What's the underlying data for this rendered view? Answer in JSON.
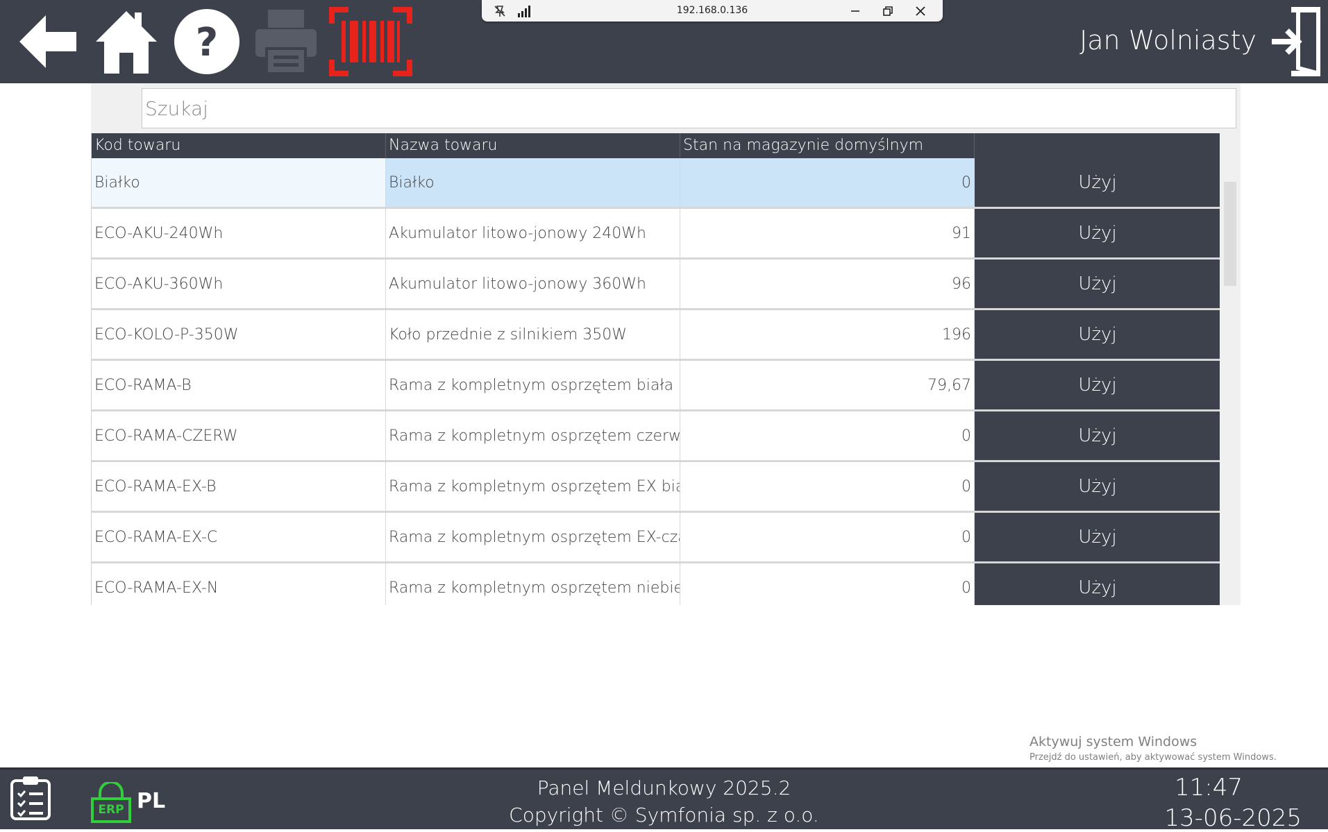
{
  "header": {
    "user_name": "Jan Wolniasty",
    "icons": [
      "back-arrow-icon",
      "home-icon",
      "help-icon",
      "printer-icon",
      "barcode-scanner-icon",
      "logout-icon"
    ]
  },
  "remote_session": {
    "address": "192.168.0.136"
  },
  "search": {
    "placeholder": "Szukaj",
    "value": ""
  },
  "table": {
    "columns": [
      "Kod towaru",
      "Nazwa towaru",
      "Stan na magazynie domyślnym",
      ""
    ],
    "rows": [
      {
        "code": "Białko",
        "name": "Białko",
        "stock": "0",
        "action": "Użyj"
      },
      {
        "code": "ECO-AKU-240Wh",
        "name": "Akumulator litowo-jonowy 240Wh",
        "stock": "91",
        "action": "Użyj"
      },
      {
        "code": "ECO-AKU-360Wh",
        "name": "Akumulator litowo-jonowy 360Wh",
        "stock": "96",
        "action": "Użyj"
      },
      {
        "code": "ECO-KOLO-P-350W",
        "name": "Koło przednie z silnikiem 350W",
        "stock": "196",
        "action": "Użyj"
      },
      {
        "code": "ECO-RAMA-B",
        "name": "Rama z kompletnym osprzętem biała",
        "stock": "79,67",
        "action": "Użyj"
      },
      {
        "code": "ECO-RAMA-CZERW",
        "name": "Rama z kompletnym osprzętem czerwona",
        "stock": "0",
        "action": "Użyj"
      },
      {
        "code": "ECO-RAMA-EX-B",
        "name": "Rama z kompletnym osprzętem EX biała",
        "stock": "0",
        "action": "Użyj"
      },
      {
        "code": "ECO-RAMA-EX-C",
        "name": "Rama z kompletnym osprzętem EX-czar...",
        "stock": "0",
        "action": "Użyj"
      },
      {
        "code": "ECO-RAMA-EX-N",
        "name": "Rama z kompletnym osprzętem niebieska",
        "stock": "0",
        "action": "Użyj"
      }
    ]
  },
  "watermark": {
    "line1": "Aktywuj system Windows",
    "line2": "Przejdź do ustawień, aby aktywować system Windows."
  },
  "footer": {
    "title": "Panel Meldunkowy 2025.2",
    "copyright": "Copyright © Symfonia sp. z o.o.",
    "language": "PL",
    "erp_badge": "ERP",
    "time": "11:47",
    "date": "13-06-2025"
  },
  "colors": {
    "bar": "#3d414c",
    "selected_row": "#cce4f7",
    "scanner_red": "#e8231b",
    "erp_green": "#2fd03a"
  }
}
